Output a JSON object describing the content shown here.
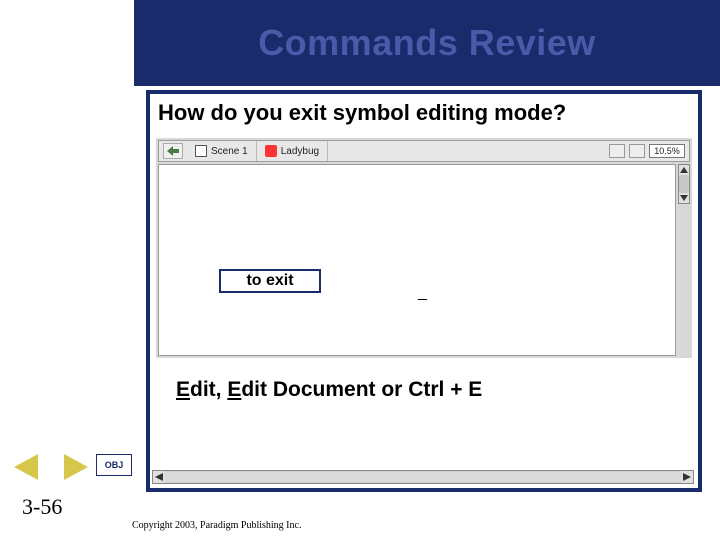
{
  "title": "Commands Review",
  "question": "How do you exit symbol editing mode?",
  "flash_bar": {
    "scene_label": "Scene 1",
    "symbol_label": "Ladybug",
    "zoom_value": "10.5%"
  },
  "exit_label": "to exit",
  "answer": {
    "prefix1": "E",
    "mid1": "dit, ",
    "prefix2": "E",
    "mid2": "dit Document or Ctrl + E"
  },
  "nav": {
    "obj_label": "OBJ"
  },
  "footer": {
    "page": "3-56",
    "copyright": "Copyright 2003, Paradigm Publishing Inc."
  }
}
